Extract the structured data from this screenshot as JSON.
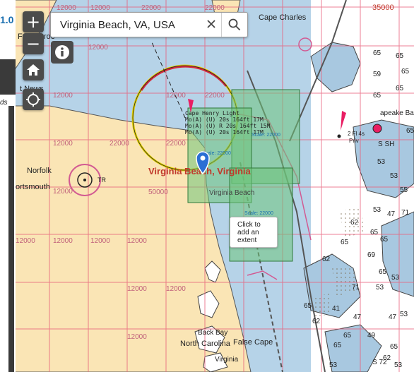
{
  "search": {
    "value": "Virginia Beach, VA, USA",
    "placeholder": ""
  },
  "controls": {
    "zoom_in": "+",
    "zoom_out": "−"
  },
  "left_panel": {
    "value": "1.0",
    "fragment": "ds"
  },
  "popup": {
    "line1": "Click to",
    "line2": "add an",
    "line3": "extent"
  },
  "map_labels": {
    "cape_charles": "Cape Charles",
    "fort_monroe": "Fort Monroe",
    "fort_monroe_partial": "Fo",
    "fort_monroe_end": "roe",
    "newport_news_partial": "t News",
    "norfolk": "Norfolk",
    "portsmouth": "ortsmouth",
    "virginia_beach_big": "Virginia Beach, Virginia",
    "virginia_beach_small": "Virginia Beach",
    "cape_henry_light": "Cape Henry Light",
    "light_line1": "Mo(A) (U) 20s 164ft 17M",
    "light_line2": "Mo(A) (U) R 20s 164ft 15M",
    "light_line3": "Mo(A) (U) 20s 164ft 17M",
    "back_bay": "Back Bay",
    "north_carolina": "North Carolina",
    "false_cape": "False Cape",
    "virginia_bottom": "Virginia",
    "chesapeake_bay": "apeake Bay",
    "fl_4s": "2 Fl 4s",
    "priv": "Priv",
    "tr": "TR",
    "scale1": "Scale: 22000",
    "scale2": "Scale: 22000",
    "scale3": "Scale: 22000",
    "label_35000": "35000",
    "label_65": "65",
    "label_sh": "S SH",
    "label_s72": "S 72"
  },
  "grid_labels": [
    "12000",
    "22000",
    "22000",
    "12000",
    "50000",
    "12000",
    "12000",
    "22000",
    "22000",
    "12000",
    "22000",
    "12000",
    "12000",
    "12000",
    "12000",
    "12000",
    "12000",
    "12000",
    "12000",
    "12000"
  ],
  "colors": {
    "land": "#fae5b5",
    "water": "#a8c8e0",
    "deep_water": "#ffffff",
    "grid": "#e8607a",
    "extent_fill": "#6ec47a",
    "extent_stroke": "#2f7a3a",
    "label_red": "#c0392b",
    "marker": "#2a6fd4",
    "control_bg": "#4b4b4b"
  }
}
